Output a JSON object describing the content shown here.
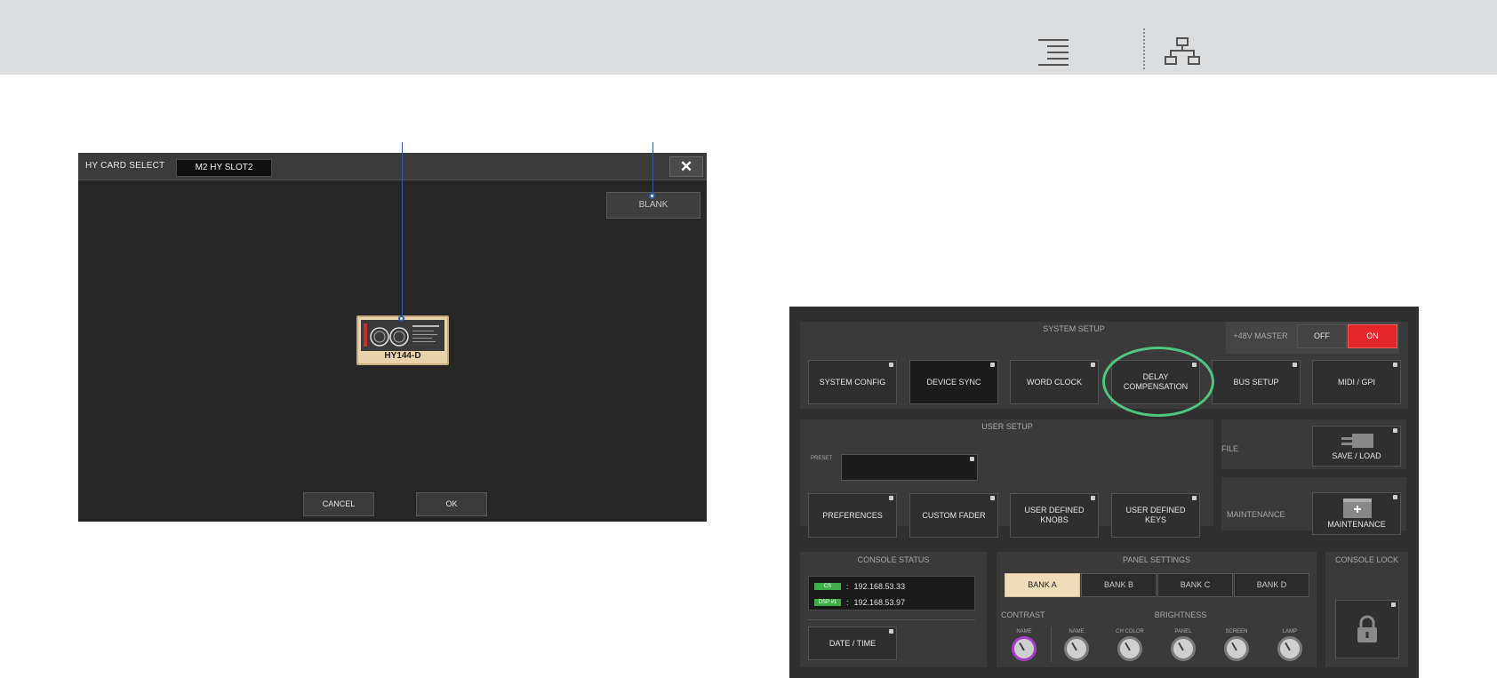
{
  "topbar": {
    "menu_icon": "menu-lines-icon",
    "tree_icon": "hierarchy-icon"
  },
  "dialog": {
    "title": "HY CARD SELECT",
    "slot": "M2  HY SLOT2",
    "close_label": "✕",
    "blank_label": "BLANK",
    "card_label": "HY144-D",
    "cancel_label": "CANCEL",
    "ok_label": "OK"
  },
  "setup": {
    "system_setup_title": "SYSTEM SETUP",
    "phantom": {
      "label": "+48V MASTER",
      "off": "OFF",
      "on": "ON"
    },
    "system_buttons": [
      "SYSTEM CONFIG",
      "DEVICE SYNC",
      "WORD CLOCK",
      "DELAY COMPENSATION",
      "BUS SETUP",
      "MIDI / GPI"
    ],
    "user_setup_title": "USER SETUP",
    "preset_label": "PRESET",
    "user_buttons": [
      "PREFERENCES",
      "CUSTOM FADER",
      "USER DEFINED KNOBS",
      "USER DEFINED KEYS"
    ],
    "file_label": "FILE",
    "save_load_label": "SAVE / LOAD",
    "maintenance_label": "MAINTENANCE",
    "maintenance_button": "MAINTENANCE",
    "console_status_title": "CONSOLE STATUS",
    "status_rows": [
      {
        "tag": "CS",
        "sep": ":",
        "ip": "192.168.53.33"
      },
      {
        "tag": "DSP #1",
        "sep": ":",
        "ip": "192.168.53.97"
      }
    ],
    "date_time_label": "DATE / TIME",
    "panel_settings_title": "PANEL SETTINGS",
    "banks": [
      "BANK A",
      "BANK B",
      "BANK C",
      "BANK D"
    ],
    "contrast_label": "CONTRAST",
    "brightness_label": "BRIGHTNESS",
    "contrast_knob": "NAME",
    "brightness_knobs": [
      "NAME",
      "CH COLOR",
      "PANEL",
      "SCREEN",
      "LAMP"
    ],
    "console_lock_title": "CONSOLE LOCK",
    "colors": {
      "on_red": "#e2262a",
      "status_green": "#3fae49",
      "highlight_green": "#52c47f",
      "callout_blue": "#2a5ea8"
    }
  }
}
